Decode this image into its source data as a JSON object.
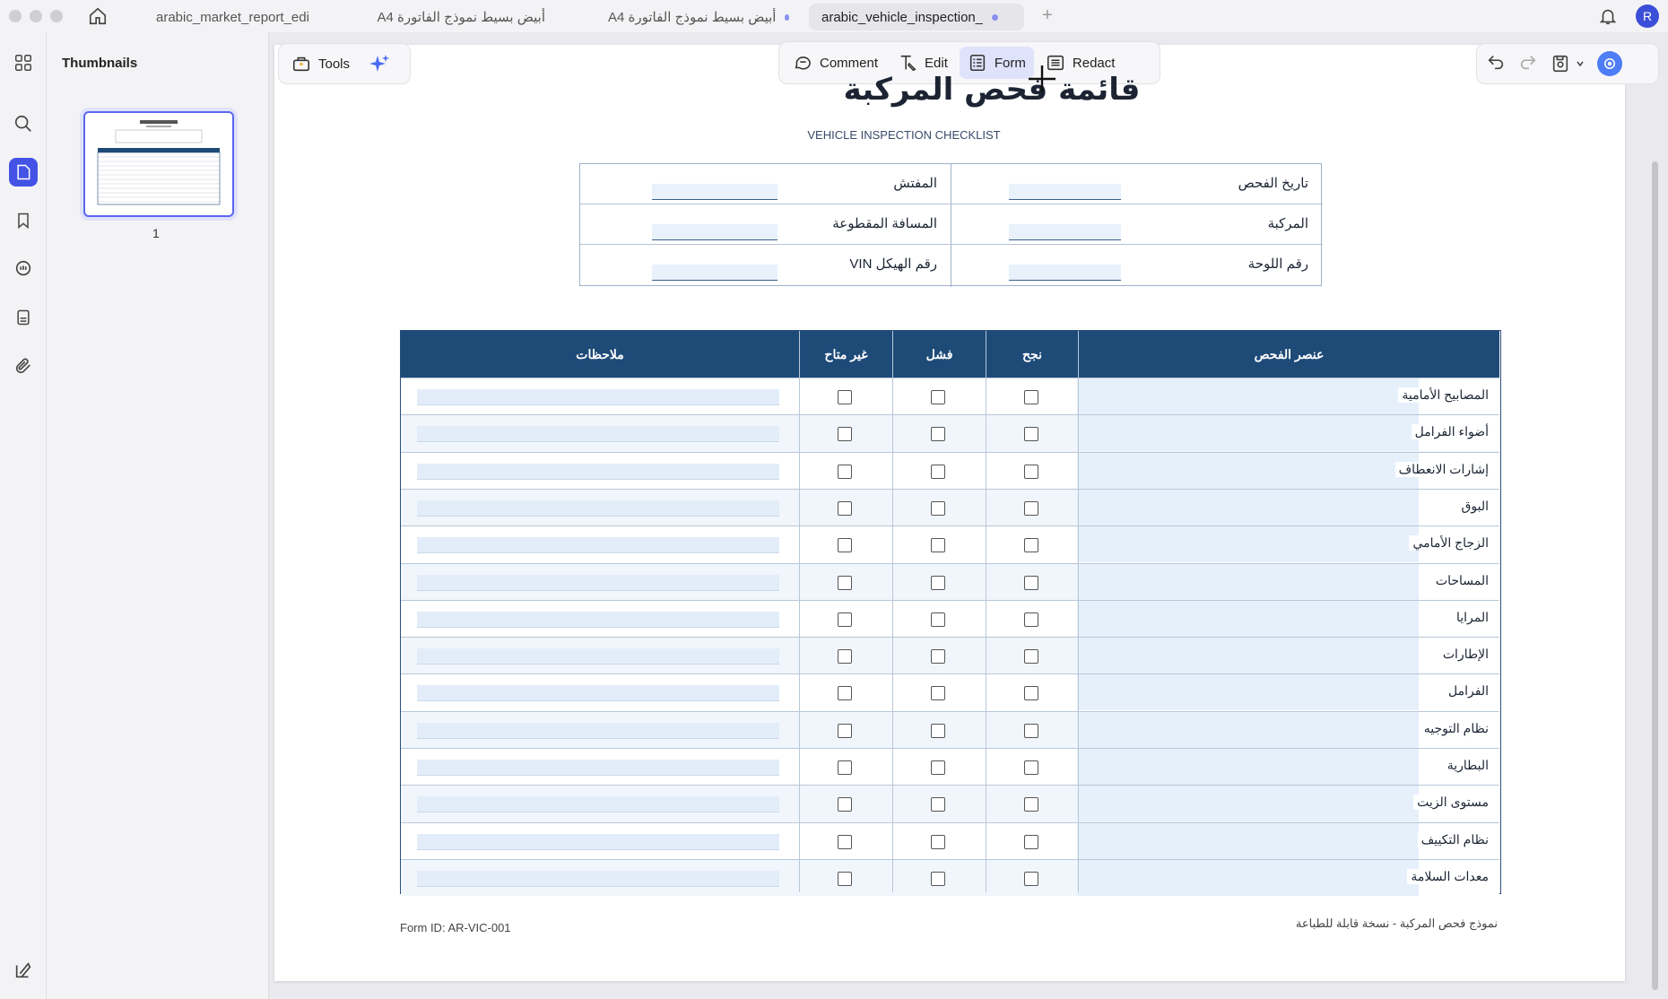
{
  "tabs": [
    {
      "label": "arabic_market_report_edi",
      "has_dot": false
    },
    {
      "label": "أبيض بسيط نموذج الفاتورة A4",
      "has_dot": false
    },
    {
      "label": "أبيض بسيط نموذج الفاتورة A4",
      "has_dot": true
    },
    {
      "label": "arabic_vehicle_inspection_",
      "has_dot": true,
      "active": true
    }
  ],
  "user": {
    "avatar_letter": "R"
  },
  "sidebar": {
    "panel_title": "Thumbnails",
    "page_number": "1"
  },
  "toolbar": {
    "tools_label": "Tools",
    "comment_label": "Comment",
    "edit_label": "Edit",
    "form_label": "Form",
    "redact_label": "Redact",
    "active_tool": "Form"
  },
  "document": {
    "title": "قائمة فحص المركبة",
    "subtitle": "VEHICLE INSPECTION CHECKLIST",
    "info_fields": {
      "right": [
        "تاريخ الفحص",
        "المركبة",
        "رقم اللوحة"
      ],
      "left": [
        "المفتش",
        "المسافة المقطوعة",
        "رقم الهيكل VIN"
      ]
    },
    "table": {
      "headers": {
        "item": "عنصر الفحص",
        "pass": "نجح",
        "fail": "فشل",
        "na": "غير متاح",
        "notes": "ملاحظات"
      },
      "rows": [
        "المصابيح الأمامية",
        "أضواء الفرامل",
        "إشارات الانعطاف",
        "البوق",
        "الزجاج الأمامي",
        "المساحات",
        "المرايا",
        "الإطارات",
        "الفرامل",
        "نظام التوجيه",
        "البطارية",
        "مستوى الزيت",
        "نظام التكييف",
        "معدات السلامة"
      ]
    },
    "footer_left": "Form ID: AR-VIC-001",
    "footer_right": "نموذج فحص المركبة - نسخة قابلة للطباعة"
  },
  "colors": {
    "accent": "#4453e6",
    "table_header": "#1e4a78",
    "field_fill": "#e3edf9"
  }
}
